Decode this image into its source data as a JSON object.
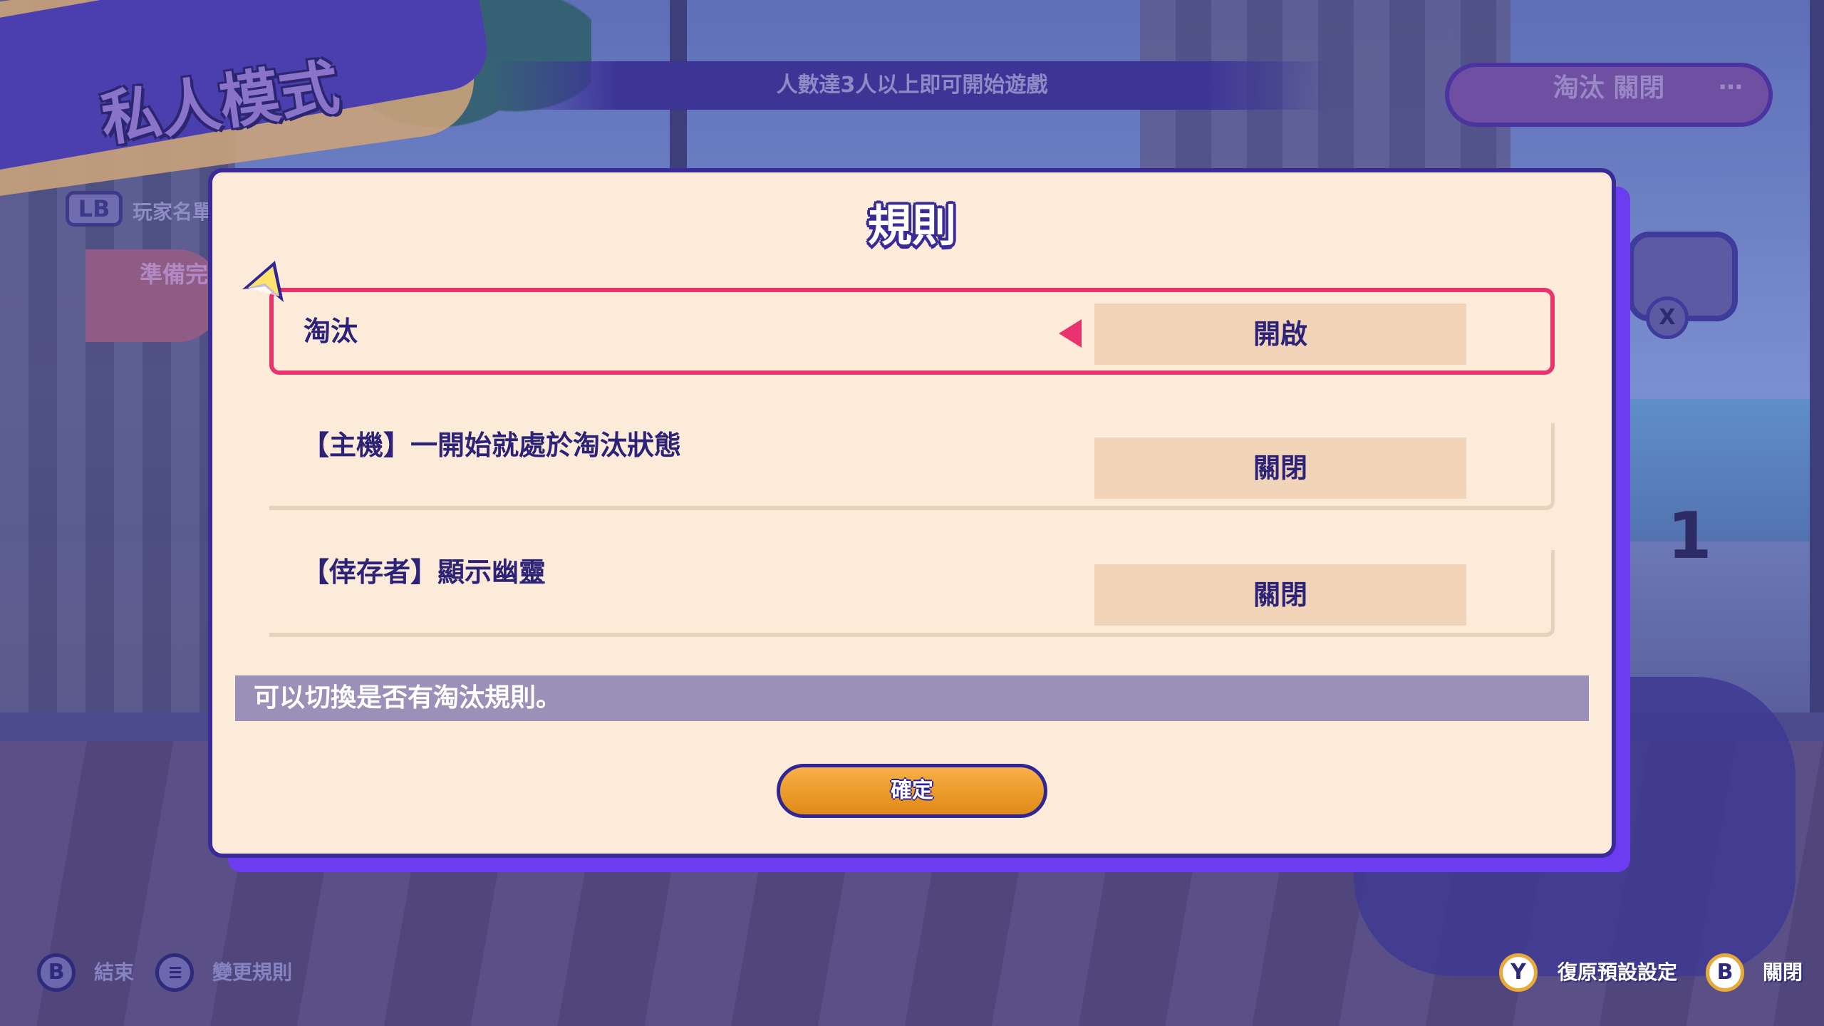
{
  "hud": {
    "mode_title": "私人模式",
    "top_info": "人數達3人以上即可開始遊戲",
    "top_chip_label": "淘汰 關閉",
    "top_chip_more": "…",
    "lb_button": "LB",
    "lb_label": "玩家名單",
    "ready_label": "準備完"
  },
  "dialog": {
    "title": "規則",
    "rows": [
      {
        "label": "淘汰",
        "value": "開啟",
        "selected": true
      },
      {
        "label": "【主機】一開始就處於淘汰狀態",
        "value": "關閉",
        "selected": false
      },
      {
        "label": "【倖存者】顯示幽靈",
        "value": "關閉",
        "selected": false
      }
    ],
    "description": "可以切換是否有淘汰規則。",
    "confirm_label": "確定"
  },
  "bottom_bar": {
    "left": [
      {
        "button": "B",
        "label": "結束"
      },
      {
        "button": "menu-icon",
        "label": "變更規則"
      }
    ],
    "right": [
      {
        "button": "Y",
        "label": "復原預設設定"
      },
      {
        "button": "B",
        "label": "關閉"
      }
    ]
  },
  "colors": {
    "dialog_bg": "#fcebd9",
    "dialog_border": "#3b2b96",
    "selection_accent": "#e8336f",
    "value_cell": "#f2d5b9",
    "confirm_button": "#eb9a28"
  }
}
